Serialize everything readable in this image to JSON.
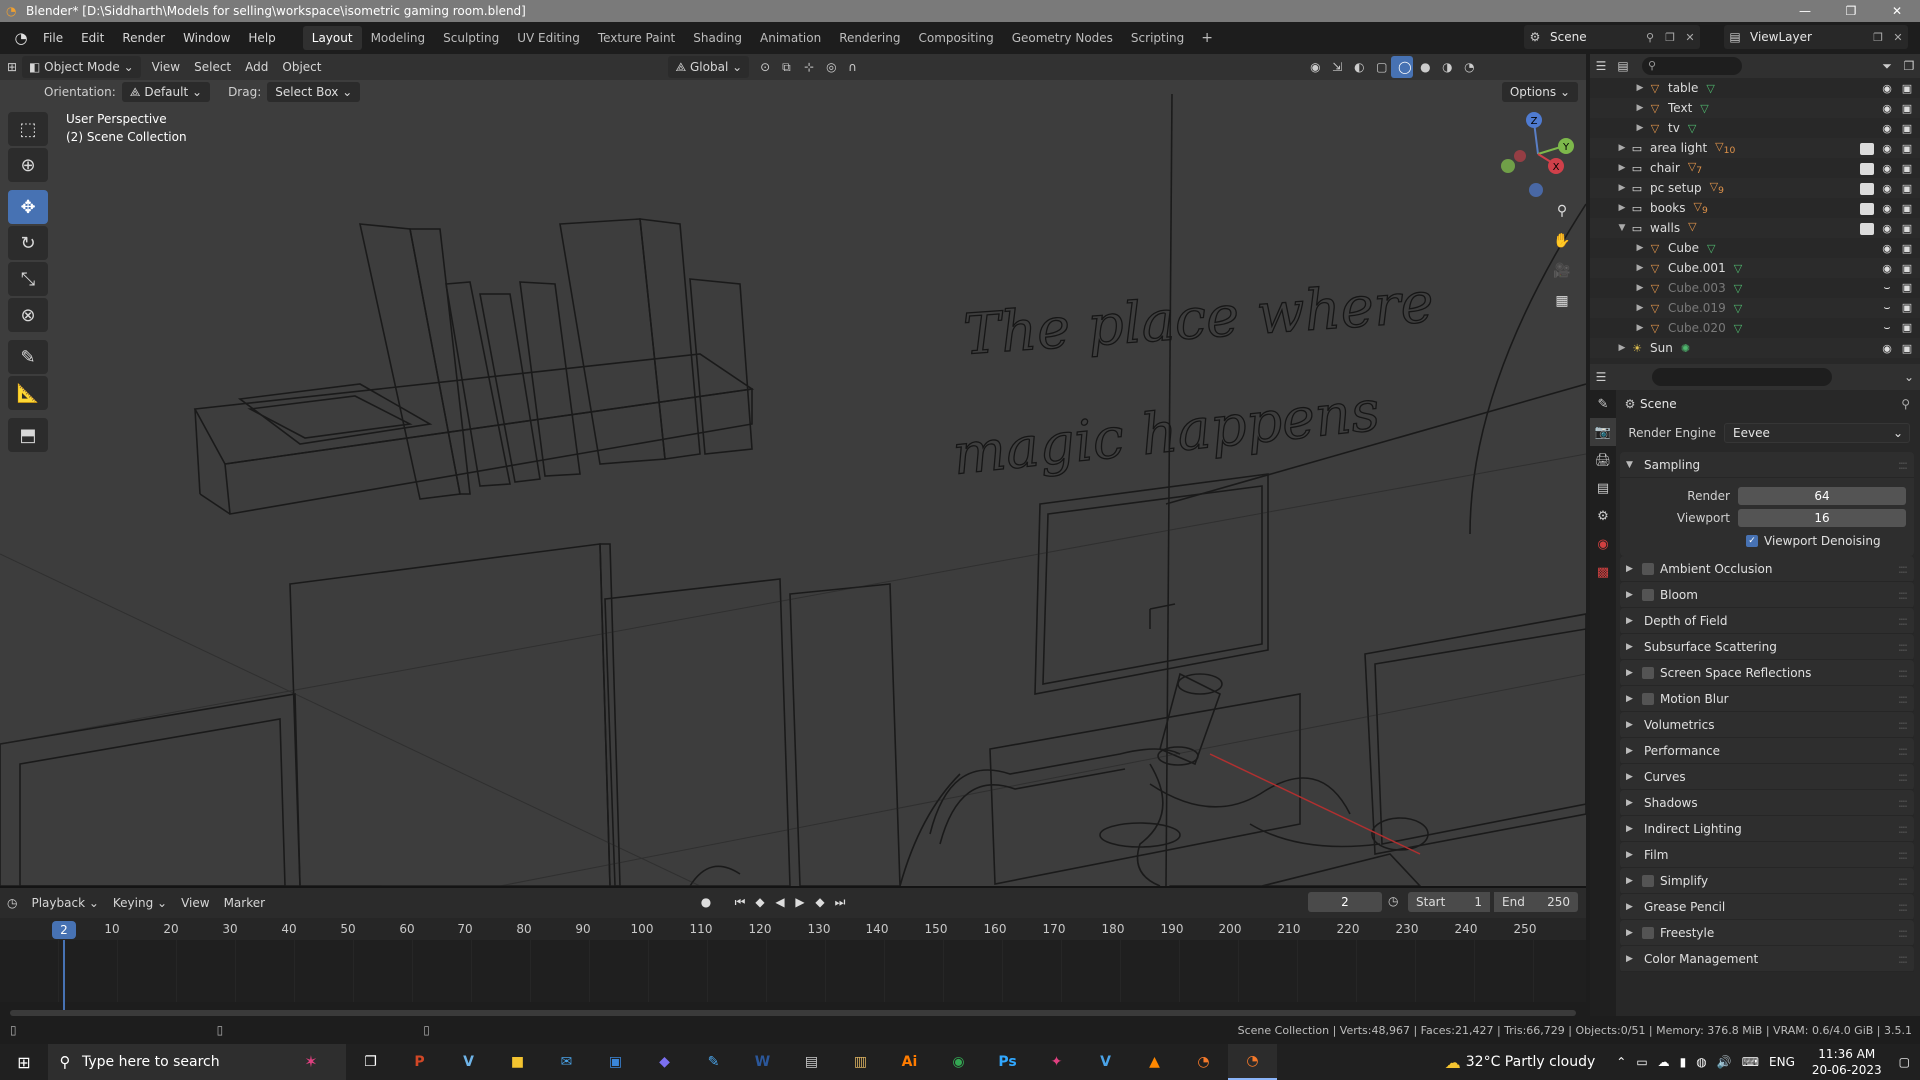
{
  "window": {
    "title": "Blender* [D:\\Siddharth\\Models for selling\\workspace\\isometric gaming room.blend]",
    "min_icon": "minimize-icon",
    "max_icon": "restore-icon",
    "close_icon": "close-icon"
  },
  "menu": {
    "items": [
      "File",
      "Edit",
      "Render",
      "Window",
      "Help"
    ],
    "workspaces": [
      "Layout",
      "Modeling",
      "Sculpting",
      "UV Editing",
      "Texture Paint",
      "Shading",
      "Animation",
      "Rendering",
      "Compositing",
      "Geometry Nodes",
      "Scripting"
    ],
    "active_workspace": "Layout",
    "add_label": "+",
    "scene_label": "Scene",
    "viewlayer_label": "ViewLayer"
  },
  "viewport": {
    "mode": "Object Mode",
    "menus": [
      "View",
      "Select",
      "Add",
      "Object"
    ],
    "transform_orientation": "Global",
    "orientation_label": "Orientation:",
    "orientation_value": "Default",
    "drag_label": "Drag:",
    "drag_value": "Select Box",
    "options_label": "Options",
    "perspective": "User Perspective",
    "collection": "(2) Scene Collection",
    "neon_line1": "The place where",
    "neon_line2": "magic happens",
    "gizmo": {
      "z": "Z",
      "y": "Y",
      "x": "X"
    }
  },
  "timeline": {
    "menus": [
      "Playback",
      "Keying",
      "View",
      "Marker"
    ],
    "current_frame": "2",
    "start_label": "Start",
    "start_value": "1",
    "end_label": "End",
    "end_value": "250",
    "ticks": [
      "10",
      "20",
      "30",
      "40",
      "50",
      "60",
      "70",
      "80",
      "90",
      "100",
      "110",
      "120",
      "130",
      "140",
      "150",
      "160",
      "170",
      "180",
      "190",
      "200",
      "210",
      "220",
      "230",
      "240",
      "250"
    ],
    "marker_frame": "2"
  },
  "status": {
    "text": "Scene Collection | Verts:48,967 | Faces:21,427 | Tris:66,729 | Objects:0/51 | Memory: 376.8 MiB | VRAM: 0.6/4.0 GiB | 3.5.1"
  },
  "outliner": {
    "rows": [
      {
        "name": "table",
        "kind": "mesh",
        "dim": false,
        "check": false
      },
      {
        "name": "Text",
        "kind": "mesh",
        "dim": false,
        "check": false
      },
      {
        "name": "tv",
        "kind": "mesh",
        "dim": false,
        "check": false
      },
      {
        "name": "area light",
        "kind": "collection",
        "badge": "10",
        "dim": false,
        "check": true
      },
      {
        "name": "chair",
        "kind": "collection",
        "badge": "7",
        "dim": false,
        "check": true
      },
      {
        "name": "pc setup",
        "kind": "collection",
        "badge": "9",
        "dim": false,
        "check": true
      },
      {
        "name": "books",
        "kind": "collection",
        "badge": "9",
        "dim": false,
        "check": true
      },
      {
        "name": "walls",
        "kind": "collection",
        "badge": "",
        "dim": false,
        "check": true
      },
      {
        "name": "Cube",
        "kind": "mesh",
        "dim": false,
        "check": false
      },
      {
        "name": "Cube.001",
        "kind": "mesh",
        "dim": false,
        "check": false
      },
      {
        "name": "Cube.003",
        "kind": "mesh",
        "dim": true,
        "check": false
      },
      {
        "name": "Cube.019",
        "kind": "mesh",
        "dim": true,
        "check": false
      },
      {
        "name": "Cube.020",
        "kind": "mesh",
        "dim": true,
        "check": false
      },
      {
        "name": "Sun",
        "kind": "light",
        "badge": "",
        "dim": false,
        "check": false
      }
    ]
  },
  "properties": {
    "scene_title": "Scene",
    "render_engine_label": "Render Engine",
    "render_engine_value": "Eevee",
    "sampling_label": "Sampling",
    "render_label": "Render",
    "render_value": "64",
    "viewport_label": "Viewport",
    "viewport_value": "16",
    "denoise_label": "Viewport Denoising",
    "panels": [
      {
        "label": "Ambient Occlusion",
        "checkbox": true
      },
      {
        "label": "Bloom",
        "checkbox": true
      },
      {
        "label": "Depth of Field",
        "checkbox": false
      },
      {
        "label": "Subsurface Scattering",
        "checkbox": false
      },
      {
        "label": "Screen Space Reflections",
        "checkbox": true
      },
      {
        "label": "Motion Blur",
        "checkbox": true
      },
      {
        "label": "Volumetrics",
        "checkbox": false
      },
      {
        "label": "Performance",
        "checkbox": false
      },
      {
        "label": "Curves",
        "checkbox": false
      },
      {
        "label": "Shadows",
        "checkbox": false
      },
      {
        "label": "Indirect Lighting",
        "checkbox": false
      },
      {
        "label": "Film",
        "checkbox": false
      },
      {
        "label": "Simplify",
        "checkbox": true
      },
      {
        "label": "Grease Pencil",
        "checkbox": false
      },
      {
        "label": "Freestyle",
        "checkbox": true
      },
      {
        "label": "Color Management",
        "checkbox": false
      }
    ]
  },
  "taskbar": {
    "search_placeholder": "Type here to search",
    "weather": "32°C  Partly cloudy",
    "lang": "ENG",
    "time": "11:36 AM",
    "date": "20-06-2023",
    "apps": [
      {
        "icon": "task-view-icon",
        "glyph": "❐",
        "color": "#ffffff"
      },
      {
        "icon": "powerpoint-icon",
        "glyph": "P",
        "color": "#d24726"
      },
      {
        "icon": "vectorize-icon",
        "glyph": "V",
        "color": "#6fb4e8"
      },
      {
        "icon": "file-explorer-icon",
        "glyph": "■",
        "color": "#f4c430"
      },
      {
        "icon": "mail-icon",
        "glyph": "✉",
        "color": "#4aa3e8"
      },
      {
        "icon": "store-icon",
        "glyph": "▣",
        "color": "#3a86d9"
      },
      {
        "icon": "media-icon",
        "glyph": "◆",
        "color": "#7b6ff0"
      },
      {
        "icon": "pen-icon",
        "glyph": "✎",
        "color": "#4aa3e8"
      },
      {
        "icon": "word-icon",
        "glyph": "W",
        "color": "#2b579a"
      },
      {
        "icon": "notes-icon",
        "glyph": "▤",
        "color": "#cccccc"
      },
      {
        "icon": "archive-icon",
        "glyph": "▥",
        "color": "#d9b060"
      },
      {
        "icon": "illustrator-icon",
        "glyph": "Ai",
        "color": "#ff7c00"
      },
      {
        "icon": "chrome-icon",
        "glyph": "◉",
        "color": "#34a853"
      },
      {
        "icon": "photoshop-icon",
        "glyph": "Ps",
        "color": "#31a8ff"
      },
      {
        "icon": "tool-icon",
        "glyph": "✦",
        "color": "#e04080"
      },
      {
        "icon": "vector-icon",
        "glyph": "V",
        "color": "#4aa3e8"
      },
      {
        "icon": "vlc-icon",
        "glyph": "▲",
        "color": "#ff8800"
      },
      {
        "icon": "blender-icon",
        "glyph": "◔",
        "color": "#f5792a"
      },
      {
        "icon": "blender-running-icon",
        "glyph": "◔",
        "color": "#f5792a"
      }
    ]
  },
  "colors": {
    "accent": "#4772b3",
    "background": "#3d3d3d",
    "panel": "#282828"
  }
}
